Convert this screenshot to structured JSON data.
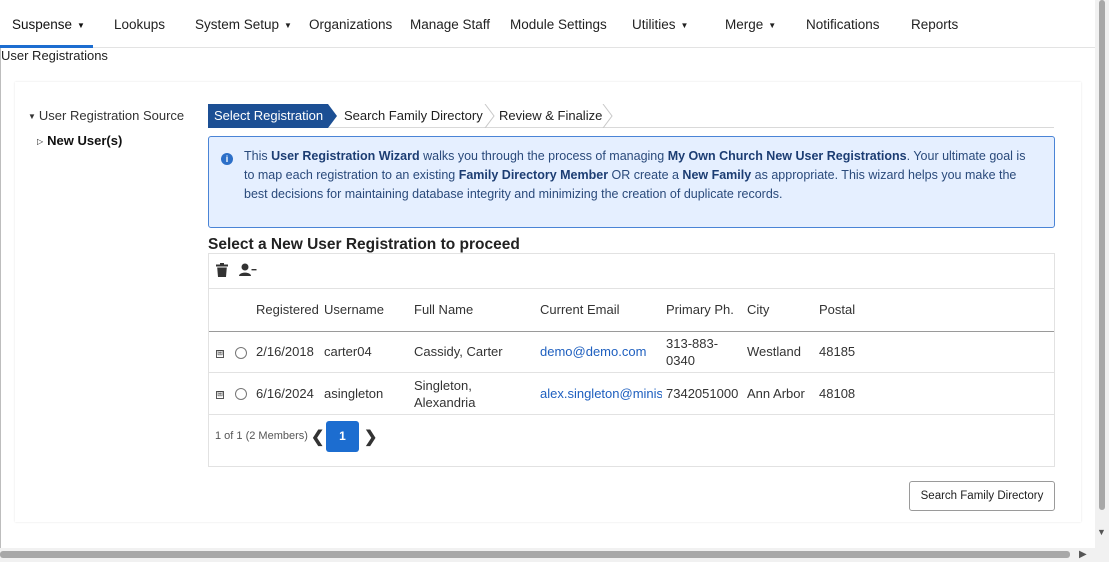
{
  "nav": {
    "items": [
      {
        "label": "Suspense",
        "caret": "▼"
      },
      {
        "label": "Lookups"
      },
      {
        "label": "System Setup",
        "caret": "▼"
      },
      {
        "label": "Organizations"
      },
      {
        "label": "Manage Staff"
      },
      {
        "label": "Module Settings"
      },
      {
        "label": "Utilities",
        "caret": "▼"
      },
      {
        "label": "Merge",
        "caret": "▼"
      },
      {
        "label": "Notifications"
      },
      {
        "label": "Reports"
      }
    ]
  },
  "breadcrumb": "User Registrations",
  "tree": {
    "root_label": "User Registration Source",
    "child_label": "New User(s)"
  },
  "wizard": {
    "steps": [
      {
        "label": "Select Registration"
      },
      {
        "label": "Search Family Directory"
      },
      {
        "label": "Review & Finalize"
      }
    ]
  },
  "info": {
    "parts": [
      "This ",
      "User Registration Wizard",
      " walks you through the process of managing ",
      "My Own Church New User Registrations",
      ". Your ultimate goal is to map each registration to an existing ",
      "Family Directory Member",
      " OR create a ",
      "New Family",
      " as appropriate. This wizard helps you make the best decisions for maintaining database integrity and minimizing the creation of duplicate records."
    ]
  },
  "section_title": "Select a New User Registration to proceed",
  "table": {
    "columns": [
      "Registered",
      "Username",
      "Full Name",
      "Current Email",
      "Primary Ph.",
      "City",
      "Postal"
    ],
    "rows": [
      {
        "registered": "2/16/2018",
        "username": "carter04",
        "full_name": "Cassidy, Carter",
        "email": "demo@demo.com",
        "phone": "313-883-0340",
        "city": "Westland",
        "postal": "48185"
      },
      {
        "registered": "6/16/2024",
        "username": "asingleton",
        "full_name": "Singleton, Alexandria",
        "email": "alex.singleton@minist",
        "phone": "7342051000",
        "city": "Ann Arbor",
        "postal": "48108"
      }
    ]
  },
  "pager": {
    "summary": "1 of 1 (2 Members)",
    "current_page": "1",
    "prev": "❮",
    "next": "❯"
  },
  "actions": {
    "search_family_directory": "Search Family Directory"
  },
  "icons": {
    "trash": "trash-icon",
    "remove_user": "user-minus-icon",
    "expand": "⊞"
  },
  "colors": {
    "accent": "#1c6dd0",
    "step_active": "#1c4f94",
    "info_bg": "#e5efff",
    "link": "#1e5fbf"
  }
}
